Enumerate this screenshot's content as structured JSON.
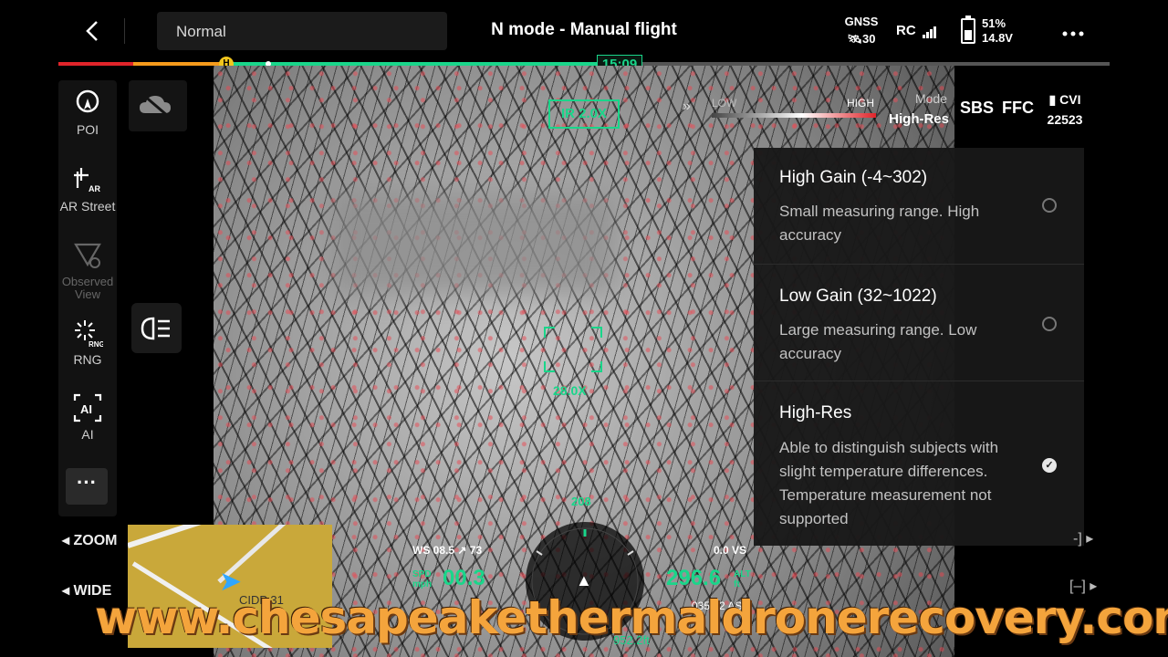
{
  "header": {
    "camera_mode": "Normal",
    "title": "N mode - Manual flight",
    "gnss_label": "GNSS",
    "gnss_count": "30",
    "rc_label": "RC",
    "battery_percent": "51%",
    "battery_voltage": "14.8V",
    "battery_level_percent": 51
  },
  "timeline": {
    "home_marker": "H",
    "time_remaining": "15:09"
  },
  "sidebar": {
    "items": [
      {
        "label": "POI",
        "icon": "poi-icon"
      },
      {
        "label": "AR Street",
        "icon": "ar-street-icon"
      },
      {
        "label": "Observed View",
        "icon": "observed-view-icon"
      },
      {
        "label": "RNG",
        "icon": "rng-icon"
      },
      {
        "label": "AI",
        "icon": "ai-icon"
      }
    ],
    "more_label": "···"
  },
  "camera": {
    "ir_zoom": "IR  2.0X",
    "low_label": "LOW",
    "high_label": "HIGH",
    "mode_label": "Mode",
    "mode_value": "High-Res",
    "sbs_label": "SBS",
    "ffc_label": "FFC",
    "cvi_label": "CVI",
    "cvi_value": "22523",
    "crosshair_zoom": "28.0X"
  },
  "gain_options": [
    {
      "title": "High Gain (-4~302)",
      "description": "Small measuring range. High accuracy",
      "selected": false
    },
    {
      "title": "Low Gain (32~1022)",
      "description": "Large measuring range. Low accuracy",
      "selected": false
    },
    {
      "title": "High-Res",
      "description": "Able to distinguish subjects with slight temperature differences. Temperature measurement not supported",
      "selected": true
    }
  ],
  "controls": {
    "zoom_label": "ZOOM",
    "wide_label": "WIDE"
  },
  "telemetry": {
    "wind": "WS 08.5",
    "wind_dir": "73",
    "speed_unit_top": "SPD",
    "speed_unit_bottom": "mph",
    "speed": "00.3",
    "vertical_speed": "0.0  VS",
    "altitude": "296.6",
    "altitude_unit_top": "ALT",
    "altitude_unit_bottom": "ft",
    "asl": "0352.2 ASL",
    "heading": "208",
    "home_distance": "952.2ft"
  },
  "map": {
    "label": "CIDP 31"
  },
  "watermark": "www.chesapeakethermaldronerecovery.com",
  "colors": {
    "accent_green": "#19d68a",
    "timeline_red": "#e0242a",
    "timeline_orange": "#f59b1c",
    "watermark_orange": "#f4a43c"
  }
}
